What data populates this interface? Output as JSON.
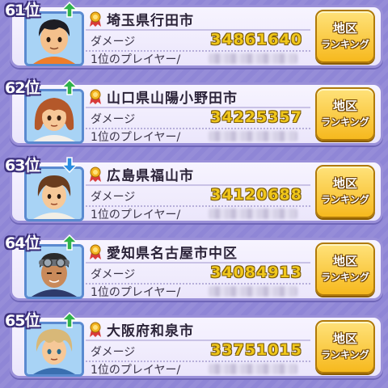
{
  "labels": {
    "damage": "ダメージ",
    "first_player": "1位のプレイヤー/",
    "button_line1": "地区",
    "button_line2": "ランキング"
  },
  "colors": {
    "up": "#2fb24a",
    "down": "#2a8de0"
  },
  "rows": [
    {
      "rank": "61位",
      "trend": "up",
      "region": "埼玉県行田市",
      "damage": "34861640",
      "avatar": "boy-black-hair"
    },
    {
      "rank": "62位",
      "trend": "up",
      "region": "山口県山陽小野田市",
      "damage": "34225357",
      "avatar": "girl-brown-hair"
    },
    {
      "rank": "63位",
      "trend": "down",
      "region": "広島県福山市",
      "damage": "34120688",
      "avatar": "boy-bowl-cut"
    },
    {
      "rank": "64位",
      "trend": "up",
      "region": "愛知県名古屋市中区",
      "damage": "34084913",
      "avatar": "man-goggles"
    },
    {
      "rank": "65位",
      "trend": "up",
      "region": "大阪府和泉市",
      "damage": "33751015",
      "avatar": "boy-blond-hair"
    }
  ]
}
